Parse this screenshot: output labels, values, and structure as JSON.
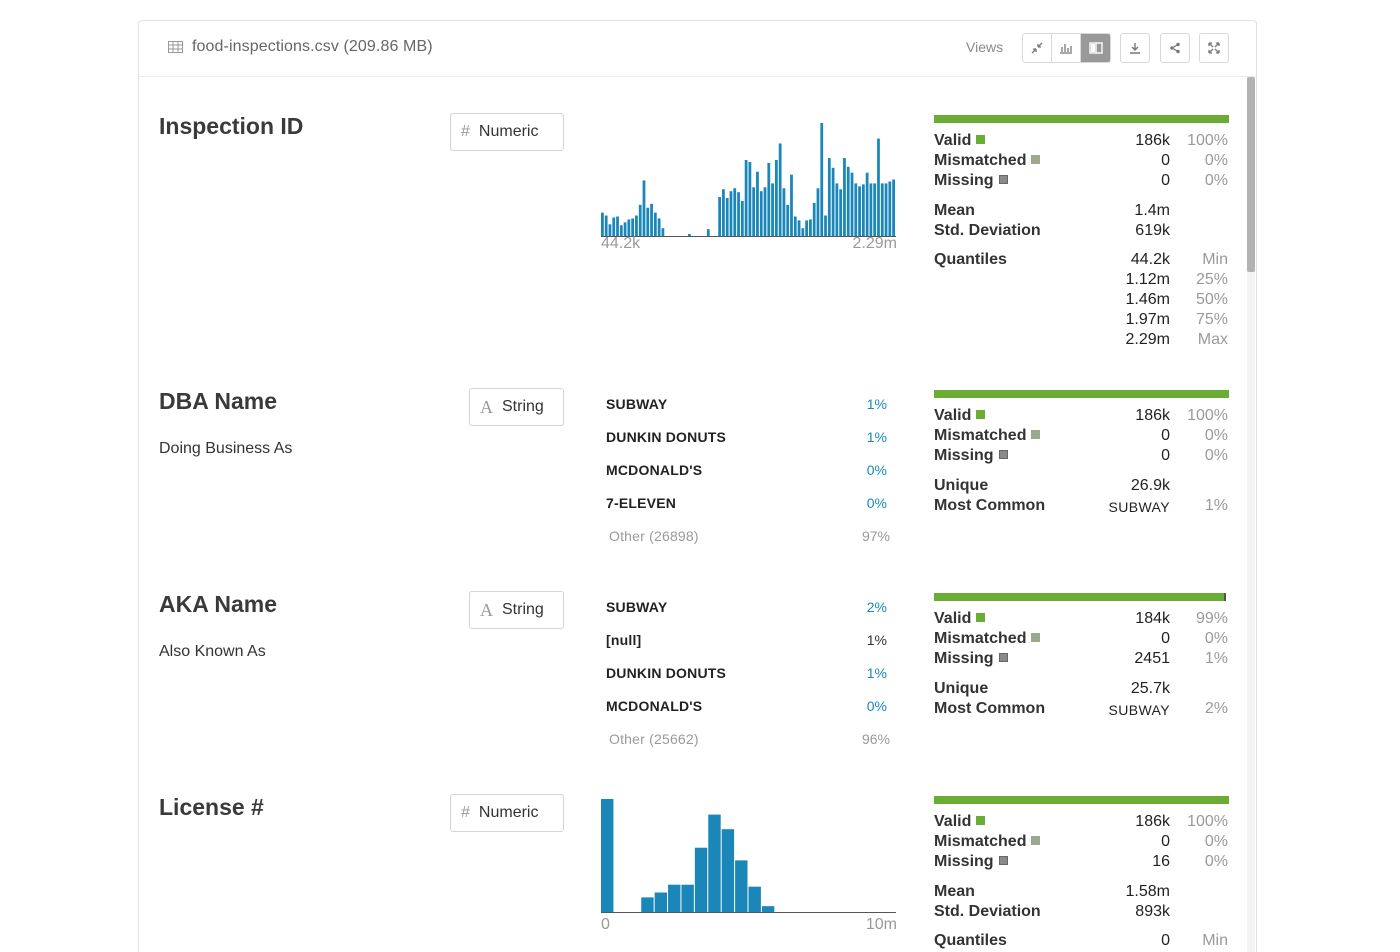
{
  "topbar": {
    "file_title": "food-inspections.csv (209.86 MB)",
    "views_label": "Views"
  },
  "colors": {
    "histogram": "#1a87b8",
    "valid": "#6aac34",
    "mismatched": "#9ea88d",
    "missing": "#8a8a8a"
  },
  "stat_labels": {
    "valid": "Valid",
    "mismatched": "Mismatched",
    "missing": "Missing"
  },
  "columns": [
    {
      "name": "Inspection ID",
      "type": "Numeric",
      "type_icon": "#",
      "quality": {
        "valid": "186k",
        "valid_pct": "100%",
        "mismatched": "0",
        "mismatched_pct": "0%",
        "missing": "0",
        "missing_pct": "0%"
      },
      "valid_fraction": 1.0,
      "histogram": {
        "min_label": "44.2k",
        "max_label": "2.29m",
        "bins": [
          24,
          21,
          12,
          19,
          20,
          11,
          14,
          17,
          18,
          21,
          32,
          57,
          29,
          33,
          24,
          18,
          8,
          0,
          0,
          0,
          0,
          0,
          0,
          2,
          0,
          0,
          0,
          0,
          7,
          0,
          0,
          40,
          48,
          39,
          46,
          49,
          45,
          36,
          78,
          76,
          50,
          66,
          46,
          50,
          75,
          54,
          78,
          95,
          49,
          32,
          63,
          20,
          16,
          8,
          16,
          17,
          34,
          49,
          116,
          21,
          80,
          70,
          54,
          48,
          80,
          71,
          65,
          54,
          51,
          53,
          65,
          54,
          54,
          100,
          54,
          54,
          56,
          58
        ]
      },
      "summary": [
        {
          "label": "Mean",
          "value": "1.4m"
        },
        {
          "label": "Std. Deviation",
          "value": "619k"
        }
      ],
      "quantiles_label": "Quantiles",
      "quantiles": [
        {
          "value": "44.2k",
          "tag": "Min"
        },
        {
          "value": "1.12m",
          "tag": "25%"
        },
        {
          "value": "1.46m",
          "tag": "50%"
        },
        {
          "value": "1.97m",
          "tag": "75%"
        },
        {
          "value": "2.29m",
          "tag": "Max"
        }
      ]
    },
    {
      "name": "DBA Name",
      "description": "Doing Business As",
      "type": "String",
      "type_icon": "A",
      "quality": {
        "valid": "186k",
        "valid_pct": "100%",
        "mismatched": "0",
        "mismatched_pct": "0%",
        "missing": "0",
        "missing_pct": "0%"
      },
      "valid_fraction": 1.0,
      "top_values": [
        {
          "label": "SUBWAY",
          "pct": "1%"
        },
        {
          "label": "DUNKIN DONUTS",
          "pct": "1%"
        },
        {
          "label": "MCDONALD'S",
          "pct": "0%"
        },
        {
          "label": "7-ELEVEN",
          "pct": "0%"
        },
        {
          "label": "Other (26898)",
          "pct": "97%",
          "other": true
        }
      ],
      "unique_label": "Unique",
      "unique": "26.9k",
      "most_common_label": "Most Common",
      "most_common": "SUBWAY",
      "most_common_pct": "1%"
    },
    {
      "name": "AKA Name",
      "description": "Also Known As",
      "type": "String",
      "type_icon": "A",
      "quality": {
        "valid": "184k",
        "valid_pct": "99%",
        "mismatched": "0",
        "mismatched_pct": "0%",
        "missing": "2451",
        "missing_pct": "1%"
      },
      "valid_fraction": 0.99,
      "top_values": [
        {
          "label": "SUBWAY",
          "pct": "2%"
        },
        {
          "label": "[null]",
          "pct": "1%",
          "null": true
        },
        {
          "label": "DUNKIN DONUTS",
          "pct": "1%"
        },
        {
          "label": "MCDONALD'S",
          "pct": "0%"
        },
        {
          "label": "Other (25662)",
          "pct": "96%",
          "other": true
        }
      ],
      "unique_label": "Unique",
      "unique": "25.7k",
      "most_common_label": "Most Common",
      "most_common": "SUBWAY",
      "most_common_pct": "2%"
    },
    {
      "name": "License #",
      "type": "Numeric",
      "type_icon": "#",
      "quality": {
        "valid": "186k",
        "valid_pct": "100%",
        "mismatched": "0",
        "mismatched_pct": "0%",
        "missing": "16",
        "missing_pct": "0%"
      },
      "valid_fraction": 1.0,
      "histogram": {
        "min_label": "0",
        "max_label": "10m",
        "bins": [
          116,
          0,
          0,
          15,
          20,
          28,
          28,
          66,
          100,
          85,
          53,
          26,
          6,
          0,
          0,
          0,
          0,
          0,
          0,
          0,
          0,
          0
        ]
      },
      "summary": [
        {
          "label": "Mean",
          "value": "1.58m"
        },
        {
          "label": "Std. Deviation",
          "value": "893k"
        }
      ],
      "quantiles_label": "Quantiles",
      "quantiles": [
        {
          "value": "0",
          "tag": "Min"
        }
      ]
    }
  ]
}
